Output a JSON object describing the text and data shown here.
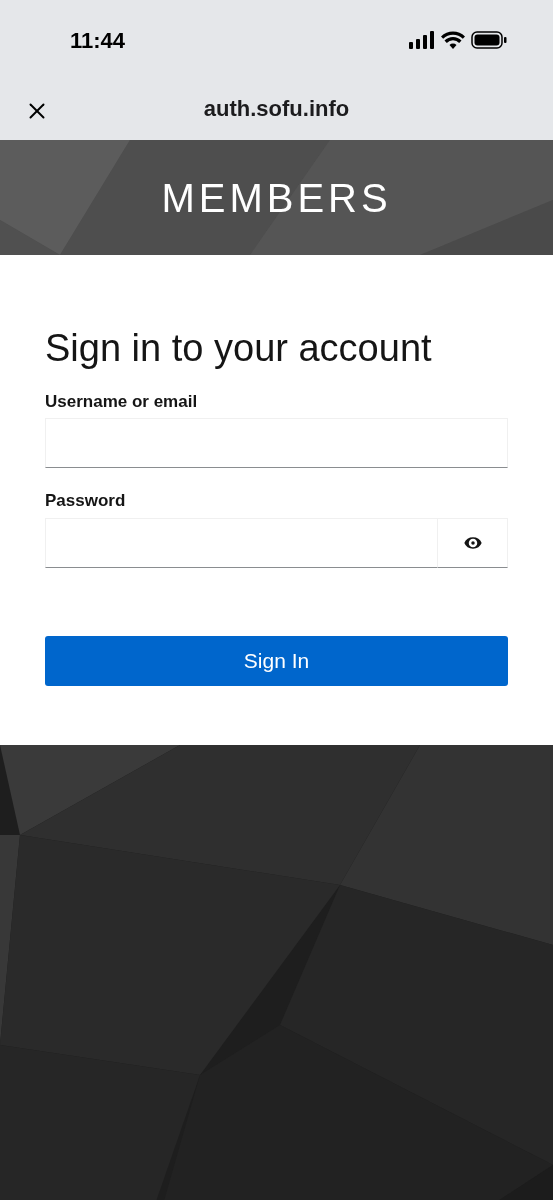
{
  "status_bar": {
    "time": "11:44"
  },
  "browser_bar": {
    "url": "auth.sofu.info"
  },
  "header": {
    "title": "MEMBERS"
  },
  "form": {
    "heading": "Sign in to your account",
    "fields": [
      {
        "kind": "text",
        "label": "Username or email"
      },
      {
        "kind": "password",
        "label": "Password"
      }
    ],
    "submit": "Sign In"
  }
}
